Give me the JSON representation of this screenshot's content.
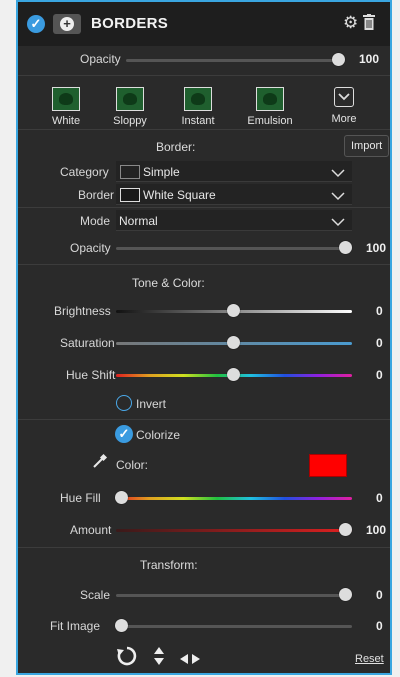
{
  "header": {
    "title": "BORDERS"
  },
  "top": {
    "opacity_label": "Opacity",
    "opacity_value": "100",
    "opacity_fraction": 0.93
  },
  "presets": [
    "White",
    "Sloppy",
    "Instant",
    "Emulsion"
  ],
  "more_label": "More",
  "border": {
    "section_label": "Border:",
    "import_label": "Import",
    "category_label": "Category",
    "category_value": "Simple",
    "border_label": "Border",
    "border_value": "White Square",
    "mode_label": "Mode",
    "mode_value": "Normal",
    "opacity_label": "Opacity",
    "opacity_value": "100",
    "opacity_fraction": 1.0
  },
  "tone": {
    "section_label": "Tone & Color:",
    "brightness_label": "Brightness",
    "brightness_value": "0",
    "saturation_label": "Saturation",
    "saturation_value": "0",
    "hue_shift_label": "Hue Shift",
    "hue_shift_value": "0",
    "invert_label": "Invert",
    "colorize_label": "Colorize",
    "color_label": "Color:",
    "color_swatch": "#ff0000",
    "hue_fill_label": "Hue Fill",
    "hue_fill_value": "0",
    "amount_label": "Amount",
    "amount_value": "100"
  },
  "transform": {
    "section_label": "Transform:",
    "scale_label": "Scale",
    "scale_value": "0",
    "fit_label": "Fit Image",
    "fit_value": "0"
  },
  "footer": {
    "reset_label": "Reset"
  },
  "colors": {
    "accent": "#3aa6e0",
    "panel": "#2a2a2a",
    "header": "#1e1e1e"
  }
}
